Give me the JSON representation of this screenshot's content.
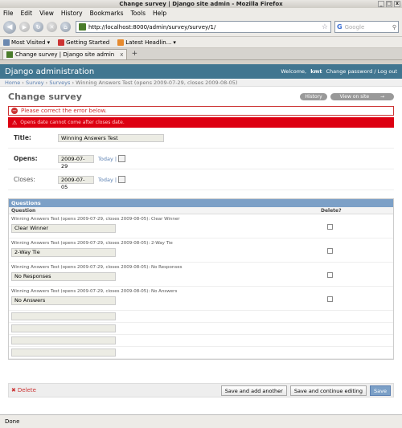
{
  "window": {
    "title": "Change survey | Django site admin - Mozilla Firefox",
    "buttons": [
      "_",
      "□",
      "x"
    ]
  },
  "menu": [
    "File",
    "Edit",
    "View",
    "History",
    "Bookmarks",
    "Tools",
    "Help"
  ],
  "nav": {
    "url": "http://localhost:8000/admin/survey/survey/1/",
    "search_placeholder": "Google",
    "search_g": "G"
  },
  "bookmarks": [
    {
      "label": "Most Visited",
      "arrow": "▾",
      "icon": "most-visited-icon"
    },
    {
      "label": "Getting Started",
      "arrow": "",
      "icon": "getting-started-icon"
    },
    {
      "label": "Latest Headlin...",
      "arrow": "▾",
      "icon": "rss-icon"
    }
  ],
  "tab": {
    "label": "Change survey | Django site admin",
    "close": "x",
    "new": "+"
  },
  "header": {
    "brand": "Django administration",
    "welcome": "Welcome,",
    "username": "kmt",
    "change_password": "Change password",
    "separator": "/",
    "logout": "Log out"
  },
  "breadcrumbs": {
    "home": "Home",
    "sep": "›",
    "app": "Survey",
    "model": "Surveys",
    "current": "Winning Answers Test (opens 2009-07-29, closes 2009-08-05)"
  },
  "page": {
    "title": "Change survey",
    "history": "History",
    "view_on_site": "View on site",
    "view_arrow": "→",
    "error_note": "Please correct the error below.",
    "error_detail": "Opens date cannot come after closes date."
  },
  "form": {
    "title_label": "Title:",
    "title_value": "Winning Answers Test",
    "opens_label": "Opens:",
    "opens_value": "2009-07-29",
    "closes_label": "Closes:",
    "closes_value": "2009-07-05",
    "today": "Today",
    "today_sep": "|"
  },
  "questions": {
    "caption": "Questions",
    "col_question": "Question",
    "col_delete": "Delete?",
    "rows": [
      {
        "original": "Winning Answers Test (opens 2009-07-29, closes 2009-08-05): Clear Winner",
        "value": "Clear Winner"
      },
      {
        "original": "Winning Answers Test (opens 2009-07-29, closes 2009-08-05): 2-Way Tie",
        "value": "2-Way Tie"
      },
      {
        "original": "Winning Answers Test (opens 2009-07-29, closes 2009-08-05): No Responses",
        "value": "No Responses"
      },
      {
        "original": "Winning Answers Test (opens 2009-07-29, closes 2009-08-05): No Answers",
        "value": "No Answers"
      }
    ]
  },
  "submit": {
    "delete": "Delete",
    "save_add": "Save and add another",
    "save_continue": "Save and continue editing",
    "save": "Save"
  },
  "status": "Done"
}
